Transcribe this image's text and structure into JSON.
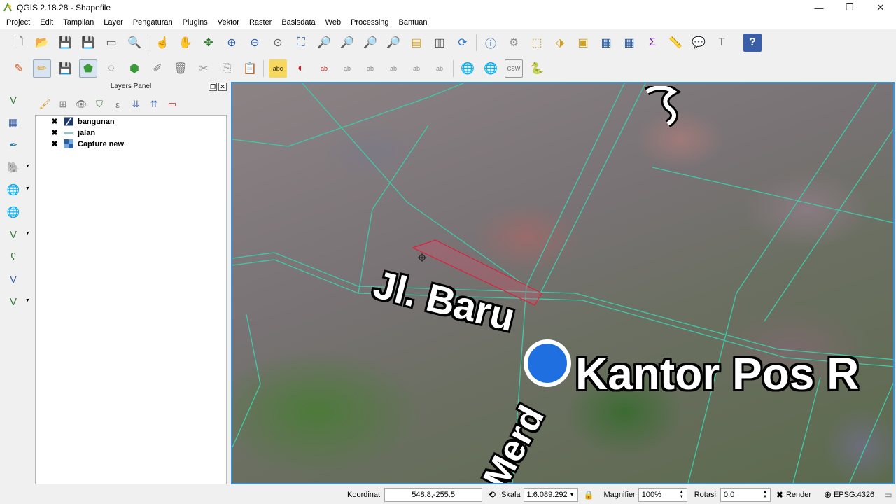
{
  "window": {
    "title": "QGIS 2.18.28 - Shapefile",
    "minimize": "—",
    "maximize": "❐",
    "close": "✕"
  },
  "menu": [
    "Project",
    "Edit",
    "Tampilan",
    "Layer",
    "Pengaturan",
    "Plugins",
    "Vektor",
    "Raster",
    "Basisdata",
    "Web",
    "Processing",
    "Bantuan"
  ],
  "layers_panel": {
    "title": "Layers Panel",
    "layers": [
      {
        "name": "bangunan",
        "checked": "✖",
        "selected": true
      },
      {
        "name": "jalan",
        "checked": "✖",
        "selected": false
      },
      {
        "name": "Capture new",
        "checked": "✖",
        "selected": false
      }
    ]
  },
  "map": {
    "labels": [
      "Jl. Baru",
      "Kantor Pos R",
      "Merd"
    ]
  },
  "status": {
    "coord_label": "Koordinat",
    "coord_value": "548.8,-255.5",
    "scale_label": "Skala",
    "scale_value": "1:6.089.292",
    "magnifier_label": "Magnifier",
    "magnifier_value": "100%",
    "rotation_label": "Rotasi",
    "rotation_value": "0,0",
    "render_label": "Render",
    "render_checked": "✖",
    "crs": "EPSG:4326"
  }
}
